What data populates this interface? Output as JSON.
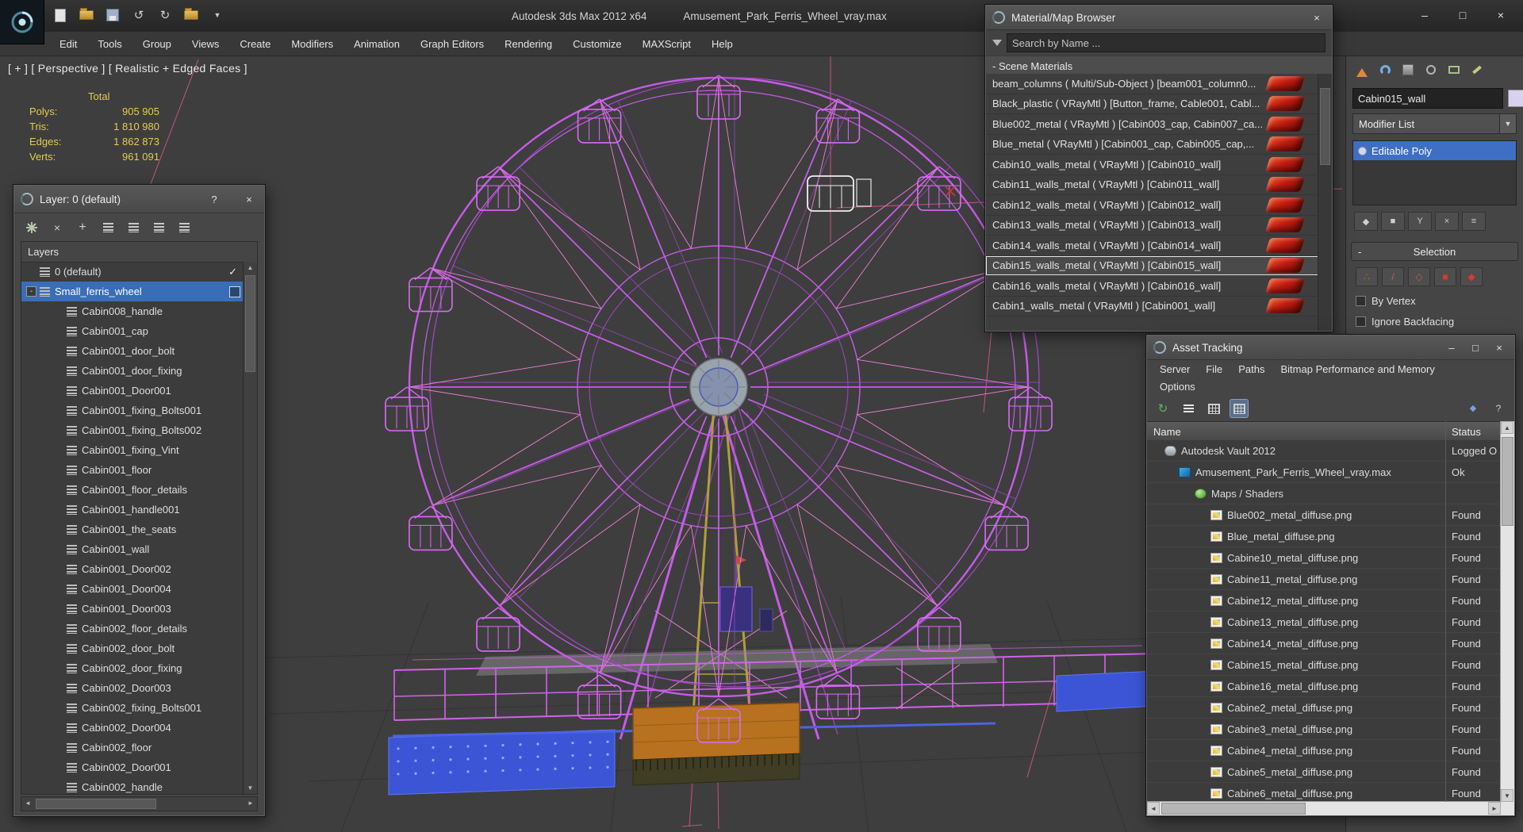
{
  "titlebar": {
    "app_title": "Autodesk 3ds Max 2012 x64",
    "file_title": "Amusement_Park_Ferris_Wheel_vray.max"
  },
  "menubar": {
    "items": [
      "Edit",
      "Tools",
      "Group",
      "Views",
      "Create",
      "Modifiers",
      "Animation",
      "Graph Editors",
      "Rendering",
      "Customize",
      "MAXScript",
      "Help"
    ]
  },
  "viewport": {
    "label": "[ + ] [ Perspective ] [ Realistic + Edged Faces ]",
    "stats": {
      "total_label": "Total",
      "polys_label": "Polys:",
      "polys_value": "905 905",
      "tris_label": "Tris:",
      "tris_value": "1 810 980",
      "edges_label": "Edges:",
      "edges_value": "1 862 873",
      "verts_label": "Verts:",
      "verts_value": "961 091"
    }
  },
  "layer_window": {
    "title": "Layer: 0 (default)",
    "list_header": "Layers",
    "rows": [
      {
        "label": "0 (default)",
        "level": 1,
        "check": "✓"
      },
      {
        "label": "Small_ferris_wheel",
        "level": 1,
        "selected": true,
        "expand": "-"
      },
      {
        "label": "Cabin008_handle",
        "level": 2
      },
      {
        "label": "Cabin001_cap",
        "level": 2
      },
      {
        "label": "Cabin001_door_bolt",
        "level": 2
      },
      {
        "label": "Cabin001_door_fixing",
        "level": 2
      },
      {
        "label": "Cabin001_Door001",
        "level": 2
      },
      {
        "label": "Cabin001_fixing_Bolts001",
        "level": 2
      },
      {
        "label": "Cabin001_fixing_Bolts002",
        "level": 2
      },
      {
        "label": "Cabin001_fixing_Vint",
        "level": 2
      },
      {
        "label": "Cabin001_floor",
        "level": 2
      },
      {
        "label": "Cabin001_floor_details",
        "level": 2
      },
      {
        "label": "Cabin001_handle001",
        "level": 2
      },
      {
        "label": "Cabin001_the_seats",
        "level": 2
      },
      {
        "label": "Cabin001_wall",
        "level": 2
      },
      {
        "label": "Cabin001_Door002",
        "level": 2
      },
      {
        "label": "Cabin001_Door004",
        "level": 2
      },
      {
        "label": "Cabin001_Door003",
        "level": 2
      },
      {
        "label": "Cabin002_floor_details",
        "level": 2
      },
      {
        "label": "Cabin002_door_bolt",
        "level": 2
      },
      {
        "label": "Cabin002_door_fixing",
        "level": 2
      },
      {
        "label": "Cabin002_Door003",
        "level": 2
      },
      {
        "label": "Cabin002_fixing_Bolts001",
        "level": 2
      },
      {
        "label": "Cabin002_Door004",
        "level": 2
      },
      {
        "label": "Cabin002_floor",
        "level": 2
      },
      {
        "label": "Cabin002_Door001",
        "level": 2
      },
      {
        "label": "Cabin002_handle",
        "level": 2
      }
    ]
  },
  "material_browser": {
    "title": "Material/Map Browser",
    "search_value": "Search by Name ...",
    "group_header": "- Scene Materials",
    "items": [
      {
        "text": "beam_columns ( Multi/Sub-Object ) [beam001_column0..."
      },
      {
        "text": "Black_plastic ( VRayMtl ) [Button_frame, Cable001, Cabl..."
      },
      {
        "text": "Blue002_metal ( VRayMtl ) [Cabin003_cap, Cabin007_ca..."
      },
      {
        "text": "Blue_metal ( VRayMtl ) [Cabin001_cap, Cabin005_cap,..."
      },
      {
        "text": "Cabin10_walls_metal ( VRayMtl ) [Cabin010_wall]"
      },
      {
        "text": "Cabin11_walls_metal ( VRayMtl ) [Cabin011_wall]"
      },
      {
        "text": "Cabin12_walls_metal ( VRayMtl ) [Cabin012_wall]"
      },
      {
        "text": "Cabin13_walls_metal ( VRayMtl ) [Cabin013_wall]"
      },
      {
        "text": "Cabin14_walls_metal ( VRayMtl ) [Cabin014_wall]"
      },
      {
        "text": "Cabin15_walls_metal ( VRayMtl ) [Cabin015_wall]",
        "selected": true
      },
      {
        "text": "Cabin16_walls_metal ( VRayMtl ) [Cabin016_wall]"
      },
      {
        "text": "Cabin1_walls_metal ( VRayMtl ) [Cabin001_wall]"
      }
    ]
  },
  "asset_tracking": {
    "title": "Asset Tracking",
    "menu_line1": [
      "Server",
      "File",
      "Paths",
      "Bitmap Performance and Memory"
    ],
    "menu_line2": [
      "Options"
    ],
    "columns": [
      "Name",
      "Status"
    ],
    "rows": [
      {
        "name": "Autodesk Vault 2012",
        "status": "Logged O",
        "level": 1,
        "icon": "vault"
      },
      {
        "name": "Amusement_Park_Ferris_Wheel_vray.max",
        "status": "Ok",
        "level": 2,
        "icon": "maxfile"
      },
      {
        "name": "Maps / Shaders",
        "status": "",
        "level": 3,
        "icon": "maps"
      },
      {
        "name": "Blue002_metal_diffuse.png",
        "status": "Found",
        "level": 4,
        "icon": "png"
      },
      {
        "name": "Blue_metal_diffuse.png",
        "status": "Found",
        "level": 4,
        "icon": "png"
      },
      {
        "name": "Cabine10_metal_diffuse.png",
        "status": "Found",
        "level": 4,
        "icon": "png"
      },
      {
        "name": "Cabine11_metal_diffuse.png",
        "status": "Found",
        "level": 4,
        "icon": "png"
      },
      {
        "name": "Cabine12_metal_diffuse.png",
        "status": "Found",
        "level": 4,
        "icon": "png"
      },
      {
        "name": "Cabine13_metal_diffuse.png",
        "status": "Found",
        "level": 4,
        "icon": "png"
      },
      {
        "name": "Cabine14_metal_diffuse.png",
        "status": "Found",
        "level": 4,
        "icon": "png"
      },
      {
        "name": "Cabine15_metal_diffuse.png",
        "status": "Found",
        "level": 4,
        "icon": "png"
      },
      {
        "name": "Cabine16_metal_diffuse.png",
        "status": "Found",
        "level": 4,
        "icon": "png"
      },
      {
        "name": "Cabine2_metal_diffuse.png",
        "status": "Found",
        "level": 4,
        "icon": "png"
      },
      {
        "name": "Cabine3_metal_diffuse.png",
        "status": "Found",
        "level": 4,
        "icon": "png"
      },
      {
        "name": "Cabine4_metal_diffuse.png",
        "status": "Found",
        "level": 4,
        "icon": "png"
      },
      {
        "name": "Cabine5_metal_diffuse.png",
        "status": "Found",
        "level": 4,
        "icon": "png"
      },
      {
        "name": "Cabine6_metal_diffuse.png",
        "status": "Found",
        "level": 4,
        "icon": "png"
      }
    ]
  },
  "command_panel": {
    "object_name": "Cabin015_wall",
    "modifier_list_label": "Modifier List",
    "stack_item": "Editable Poly",
    "selection_rollout": "Selection",
    "checkbox_by_vertex": "By Vertex",
    "checkbox_ignore_backfacing": "Ignore Backfacing"
  },
  "icons": {
    "close": "×",
    "help": "?",
    "minimize": "–",
    "maximize": "□",
    "check": "✓",
    "collapse": "-",
    "dropdown": "▼",
    "scroll_up": "▲",
    "scroll_down": "▼",
    "scroll_left": "◄",
    "scroll_right": "►",
    "undo": "↺",
    "redo": "↻",
    "pin_stack": "◆",
    "show_end_result": "■",
    "make_unique": "Y",
    "remove_modifier": "×",
    "configure_sets": "≡",
    "vertex": "∴",
    "edge": "/",
    "border": "◇",
    "polygon": "■",
    "element": "◆",
    "refresh": "↻"
  },
  "colors": {
    "wireframe_magenta": "#c55ce6",
    "wireframe_pink": "#ee7fd0",
    "selection_blue": "#3a6db8",
    "stats_yellow": "#e5cb4a",
    "material_swatch_red": "#c21c10",
    "platform_blue": "#3c55d6",
    "platform_orange": "#b7711f"
  }
}
